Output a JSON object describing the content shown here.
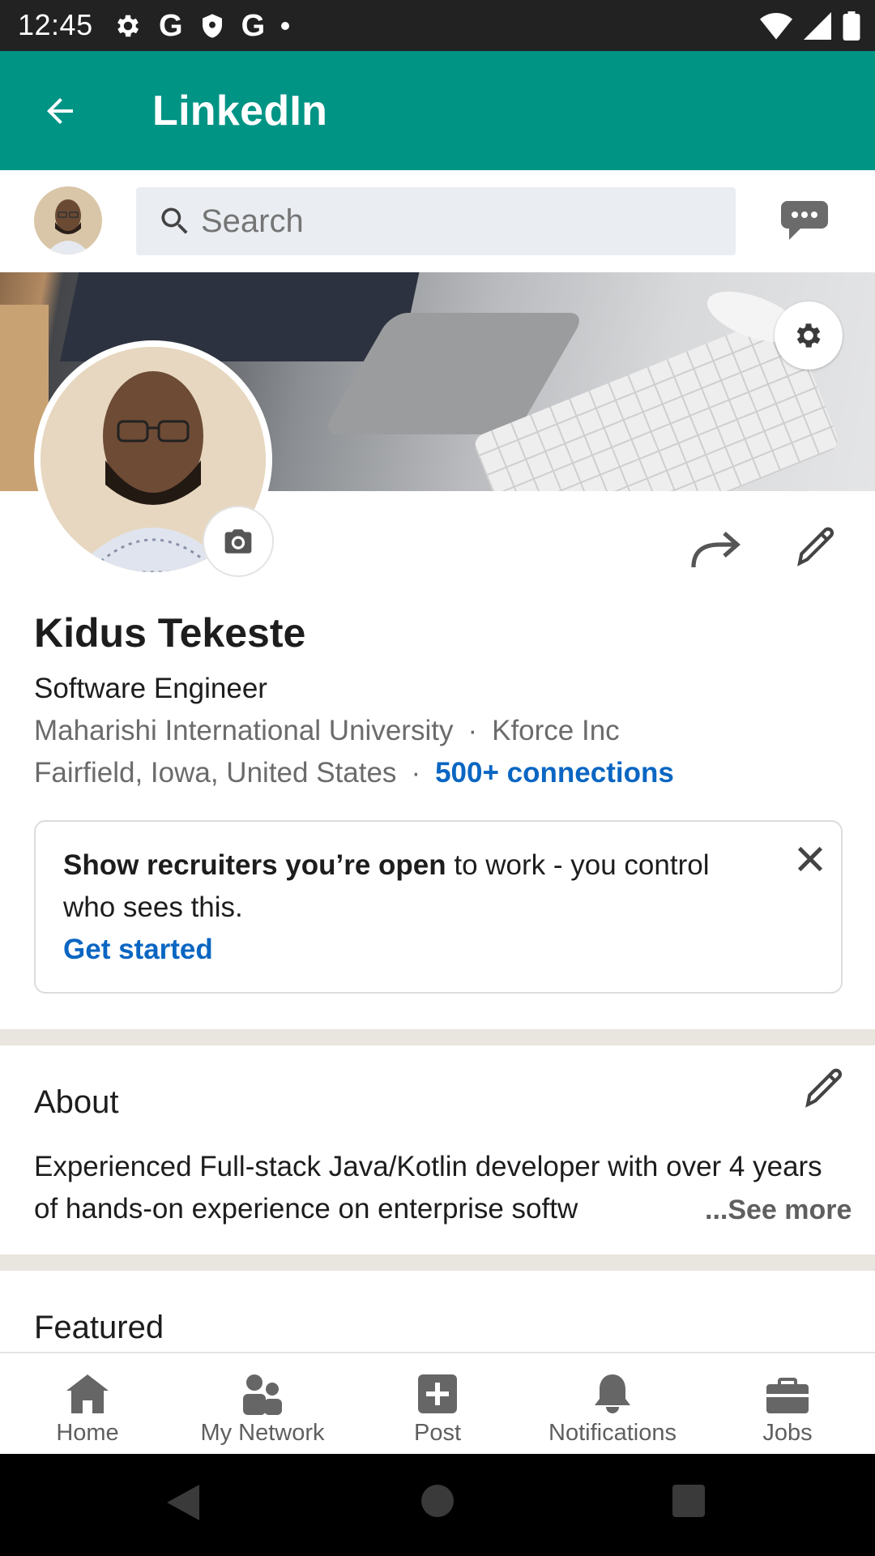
{
  "status_bar": {
    "time": "12:45",
    "icons_left": [
      "settings-icon",
      "google-icon",
      "shield-icon",
      "google-icon",
      "dot-icon"
    ],
    "icons_right": [
      "wifi-icon",
      "signal-icon",
      "battery-icon"
    ]
  },
  "app_bar": {
    "title": "LinkedIn"
  },
  "search": {
    "placeholder": "Search"
  },
  "profile": {
    "name": "Kidus Tekeste",
    "headline": "Software Engineer",
    "school": "Maharishi International University",
    "company": "Kforce Inc",
    "location": "Fairfield, Iowa, United States",
    "connections": "500+ connections",
    "separator": "·"
  },
  "open_to_work": {
    "bold_text": "Show recruiters you’re open",
    "rest_text": " to work - you control who sees this.",
    "cta": "Get started"
  },
  "about": {
    "title": "About",
    "text": "Experienced Full-stack Java/Kotlin developer with over 4 years of hands-on experience on enterprise softw",
    "see_more": "...See more"
  },
  "featured": {
    "title": "Featured"
  },
  "bottom_nav": {
    "items": [
      {
        "label": "Home",
        "icon": "home-icon"
      },
      {
        "label": "My Network",
        "icon": "network-icon"
      },
      {
        "label": "Post",
        "icon": "post-icon"
      },
      {
        "label": "Notifications",
        "icon": "bell-icon"
      },
      {
        "label": "Jobs",
        "icon": "briefcase-icon"
      }
    ]
  },
  "colors": {
    "app_bar": "#009485",
    "link_blue": "#0a66c2",
    "status_bar": "#222222"
  }
}
